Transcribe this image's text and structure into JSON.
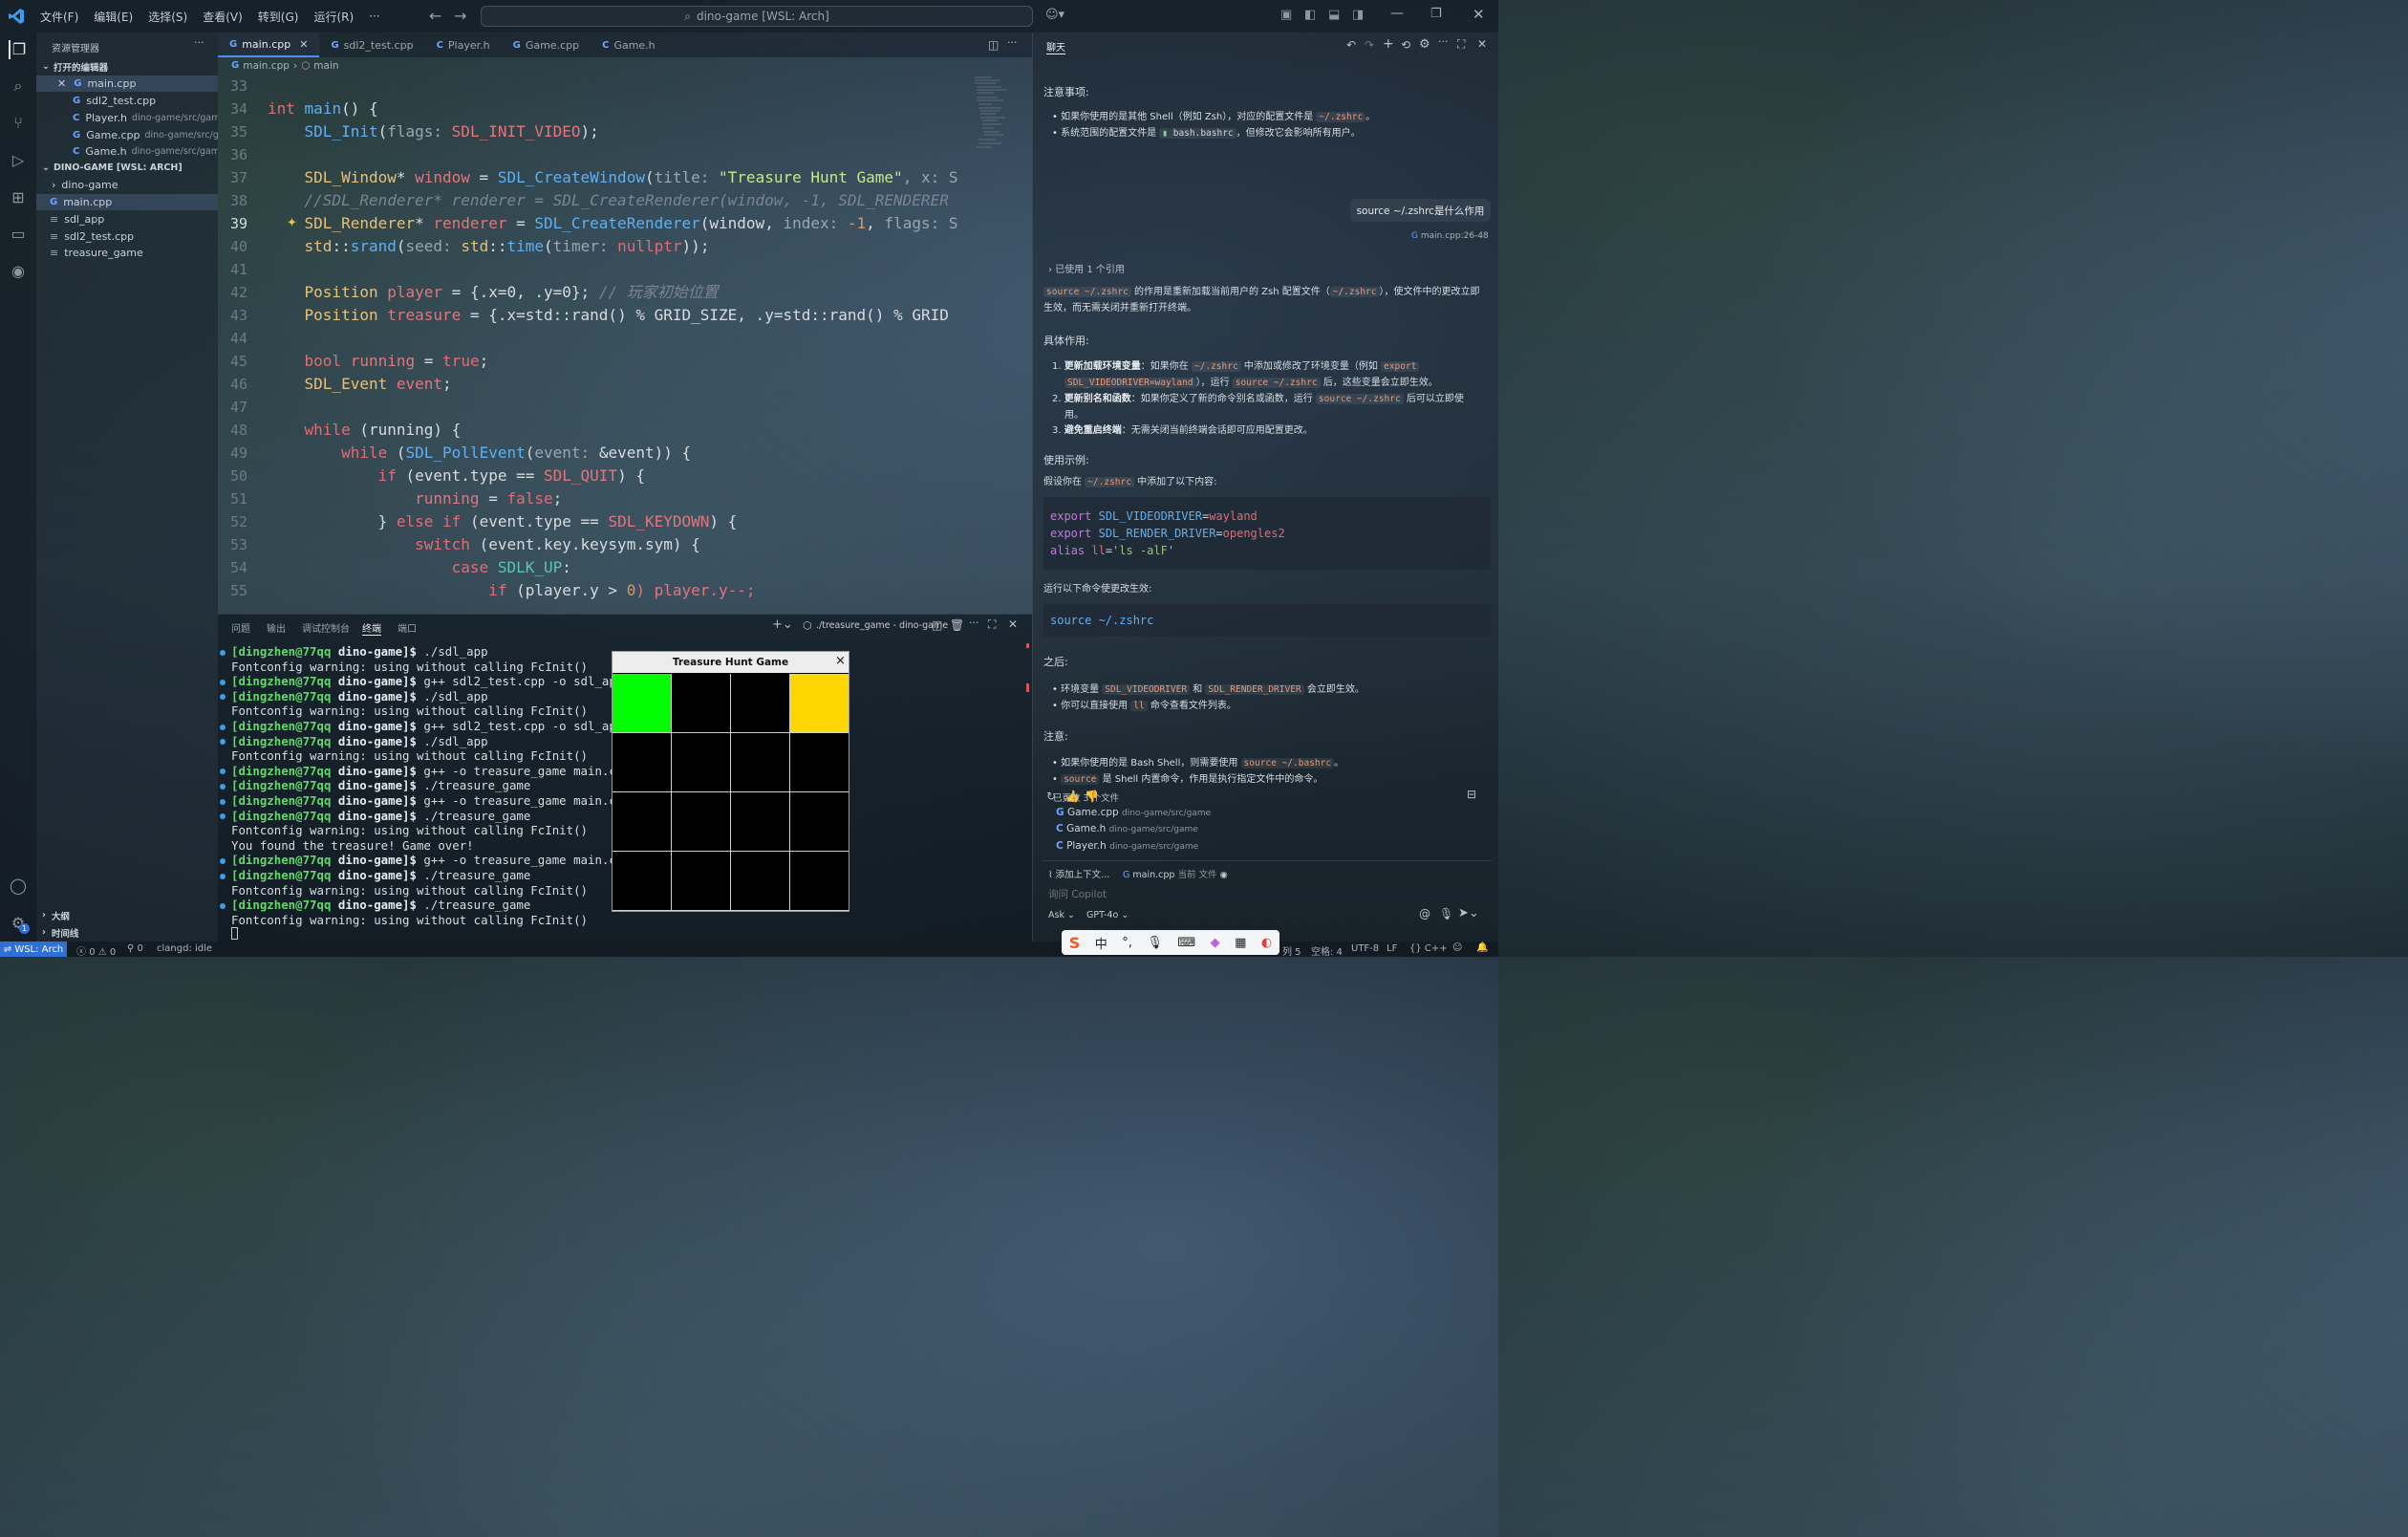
{
  "titlebar": {
    "menus": [
      "文件(F)",
      "编辑(E)",
      "选择(S)",
      "查看(V)",
      "转到(G)",
      "运行(R)",
      "···"
    ],
    "search_text": "dino-game [WSL: Arch]"
  },
  "explorer": {
    "title": "资源管理器",
    "open_editors_label": "打开的编辑器",
    "open_editors": [
      {
        "name": "main.cpp",
        "desc": ""
      },
      {
        "name": "sdl2_test.cpp",
        "desc": ""
      },
      {
        "name": "Player.h",
        "desc": "dino-game/src/game"
      },
      {
        "name": "Game.cpp",
        "desc": "dino-game/src/ga..."
      },
      {
        "name": "Game.h",
        "desc": "dino-game/src/game"
      }
    ],
    "workspace_label": "DINO-GAME [WSL: ARCH]",
    "files": [
      "dino-game",
      "main.cpp",
      "sdl_app",
      "sdl2_test.cpp",
      "treasure_game"
    ],
    "outline_label": "大纲",
    "timeline_label": "时间线"
  },
  "editor": {
    "tabs": [
      "main.cpp",
      "sdl2_test.cpp",
      "Player.h",
      "Game.cpp",
      "Game.h"
    ],
    "breadcrumb": {
      "file": "main.cpp",
      "symbol": "main"
    },
    "line_numbers": [
      "33",
      "34",
      "35",
      "36",
      "37",
      "38",
      "39",
      "40",
      "41",
      "42",
      "43",
      "44",
      "45",
      "46",
      "47",
      "48",
      "49",
      "50",
      "51",
      "52",
      "53",
      "54",
      "55"
    ],
    "current_line": "39",
    "code": {
      "l34": {
        "kw": "int",
        "fn": "main",
        "rest": "() {"
      },
      "l35": {
        "fn": "SDL_Init",
        "hint": "flags:",
        "arg": "SDL_INIT_VIDEO",
        "end": ");"
      },
      "l37": {
        "ty": "SDL_Window",
        "var": "window",
        "fn": "SDL_CreateWindow",
        "hint": "title:",
        "str": "\"Treasure Hunt Game\"",
        "tail": ", x: S"
      },
      "l38": {
        "text": "//SDL_Renderer* renderer = SDL_CreateRenderer(window, -1, SDL_RENDERER"
      },
      "l39": {
        "ty": "SDL_Renderer",
        "var": "renderer",
        "fn": "SDL_CreateRenderer",
        "arg1": "window",
        "hint2": "index:",
        "num": "-1",
        "hint3": "flags:",
        "tail": "S"
      },
      "l40": {
        "ns": "std",
        "fn": "srand",
        "hint": "seed:",
        "ns2": "std",
        "fn2": "time",
        "hint2": "timer:",
        "kw": "nullptr",
        "end": "));"
      },
      "l42": {
        "ty": "Position",
        "var": "player",
        "init": "{.x=0, .y=0};",
        "cm": "// 玩家初始位置"
      },
      "l43": {
        "ty": "Position",
        "var": "treasure",
        "init": "{.x=std::rand() % GRID_SIZE, .y=std::rand() % GRID"
      },
      "l45": {
        "kw": "bool",
        "var": "running",
        "val": "true",
        "end": ";"
      },
      "l46": {
        "ty": "SDL_Event",
        "var": "event",
        "end": ";"
      },
      "l48": {
        "kw": "while",
        "rest": "(running) {"
      },
      "l49": {
        "kw": "while",
        "fn": "SDL_PollEvent",
        "hint": "event:",
        "rest": "&event)) {"
      },
      "l50": {
        "kw": "if",
        "rest": "(event.type == ",
        "c": "SDL_QUIT",
        "end": ") {"
      },
      "l51": {
        "var": "running",
        "eq": " = ",
        "val": "false",
        "end": ";"
      },
      "l52": {
        "pre": "} ",
        "kw": "else if",
        "rest": "(event.type == ",
        "c": "SDL_KEYDOWN",
        "end": ") {"
      },
      "l53": {
        "kw": "switch",
        "rest": "(event.key.keysym.sym) {"
      },
      "l54": {
        "kw": "case",
        "c": "SDLK_UP",
        "end": ":"
      },
      "l55": {
        "kw": "if",
        "rest": "(player.y > ",
        "num": "0",
        "rest2": ") player.y--;"
      }
    }
  },
  "panel": {
    "tabs": [
      "问题",
      "输出",
      "调试控制台",
      "终端",
      "端口"
    ],
    "active_tab": "终端",
    "terminal_name": "./treasure_game - dino-game",
    "terminal_lines": [
      {
        "prompt": "[dingzhen@77qq",
        "dir": "dino-game]$",
        "cmd": " ./sdl_app",
        "dot": true
      },
      {
        "text": "Fontconfig warning: using without calling FcInit()"
      },
      {
        "prompt": "[dingzhen@77qq",
        "dir": "dino-game]$",
        "cmd": " g++ sdl2_test.cpp -o sdl_app `s",
        "dot": true
      },
      {
        "prompt": "[dingzhen@77qq",
        "dir": "dino-game]$",
        "cmd": " ./sdl_app",
        "dot": true
      },
      {
        "text": "Fontconfig warning: using without calling FcInit()"
      },
      {
        "prompt": "[dingzhen@77qq",
        "dir": "dino-game]$",
        "cmd": " g++ sdl2_test.cpp -o sdl_app `s",
        "dot": true
      },
      {
        "prompt": "[dingzhen@77qq",
        "dir": "dino-game]$",
        "cmd": " ./sdl_app",
        "dot": true
      },
      {
        "text": "Fontconfig warning: using without calling FcInit()"
      },
      {
        "prompt": "[dingzhen@77qq",
        "dir": "dino-game]$",
        "cmd": " g++ -o treasure_game main.cpp -",
        "dot": true
      },
      {
        "prompt": "[dingzhen@77qq",
        "dir": "dino-game]$",
        "cmd": " ./treasure_game",
        "dot": true
      },
      {
        "prompt": "[dingzhen@77qq",
        "dir": "dino-game]$",
        "cmd": " g++ -o treasure_game main.cpp -",
        "dot": true
      },
      {
        "prompt": "[dingzhen@77qq",
        "dir": "dino-game]$",
        "cmd": " ./treasure_game",
        "dot": true
      },
      {
        "text": "Fontconfig warning: using without calling FcInit()"
      },
      {
        "text": "You found the treasure! Game over!"
      },
      {
        "prompt": "[dingzhen@77qq",
        "dir": "dino-game]$",
        "cmd": " g++ -o treasure_game main.cpp -",
        "dot": true
      },
      {
        "prompt": "[dingzhen@77qq",
        "dir": "dino-game]$",
        "cmd": " ./treasure_game",
        "dot": true
      },
      {
        "text": "Fontconfig warning: using without calling FcInit()"
      },
      {
        "prompt": "[dingzhen@77qq",
        "dir": "dino-game]$",
        "cmd": " ./treasure_game",
        "dot": true
      },
      {
        "text": "Fontconfig warning: using without calling FcInit()"
      }
    ]
  },
  "game_window": {
    "title": "Treasure Hunt Game",
    "close_glyph": "×",
    "player_color": "#00ff00",
    "treasure_color": "#ffd700"
  },
  "chat": {
    "title": "聊天",
    "notes_heading": "注意事项:",
    "notes": [
      {
        "a": "如果你使用的是其他 Shell（例如 Zsh），对应的配置文件是 ",
        "code": "~/.zshrc",
        "b": "。"
      },
      {
        "a": "系统范围的配置文件是 ",
        "file": "bash.bashrc",
        "b": "，但修改它会影响所有用户。"
      }
    ],
    "user_question": "source ~/.zshrc是什么作用",
    "user_ref": "main.cpp:26-48",
    "refs_label": "已使用 1 个引用",
    "answer_intro": {
      "code1": "source ~/.zshrc",
      "a": " 的作用是重新加载当前用户的 Zsh 配置文件（",
      "code2": "~/.zshrc",
      "b": "），使文件中的更改立即",
      "line2": "生效，而无需关闭并重新打开终端。"
    },
    "specific_heading": "具体作用:",
    "specific": [
      {
        "bold": "更新加载环境变量",
        "a": "：如果你在 ",
        "c1": "~/.zshrc",
        "b": " 中添加或修改了环境变量（例如 ",
        "c2": "export",
        "c3": "SDL_VIDEODRIVER=wayland",
        "c": "），运行 ",
        "c4": "source ~/.zshrc",
        "d": " 后，这些变量会立即生效。"
      },
      {
        "bold": "更新别名和函数",
        "a": "：如果你定义了新的命令别名或函数，运行 ",
        "c1": "source ~/.zshrc",
        "b": " 后可以立即使",
        "line2": "用。"
      },
      {
        "bold": "避免重启终端",
        "a": "：无需关闭当前终端会话即可应用配置更改。"
      }
    ],
    "example_heading": "使用示例:",
    "example_intro": {
      "a": "假设你在 ",
      "code": "~/.zshrc",
      "b": " 中添加了以下内容:"
    },
    "example_code": [
      {
        "kw": "export",
        "var": "SDL_VIDEODRIVER",
        "val": "wayland"
      },
      {
        "kw": "export",
        "var": "SDL_RENDER_DRIVER",
        "val": "opengles2"
      },
      {
        "kw": "alias",
        "var": "ll",
        "str": "'ls -alF'"
      }
    ],
    "run_text": "运行以下命令使更改生效:",
    "run_code": "source ~/.zshrc",
    "after_heading": "之后:",
    "after": [
      {
        "a": "环境变量 ",
        "c1": "SDL_VIDEODRIVER",
        "b": " 和 ",
        "c2": "SDL_RENDER_DRIVER",
        "c": " 会立即生效。"
      },
      {
        "a": "你可以直接使用 ",
        "c1": "ll",
        "b": " 命令查看文件列表。"
      }
    ],
    "note_heading": "注意:",
    "note_items": [
      {
        "a": "如果你使用的是 Bash Shell，则需要使用 ",
        "c1": "source ~/.bashrc",
        "b": "。"
      },
      {
        "a": "",
        "c1": "source",
        "b": " 是 Shell 内置命令，作用是执行指定文件中的命令。"
      }
    ],
    "changed_label": "已更改 3 个文件",
    "changed_files": [
      {
        "name": "Game.cpp",
        "path": "dino-game/src/game"
      },
      {
        "name": "Game.h",
        "path": "dino-game/src/game"
      },
      {
        "name": "Player.h",
        "path": "dino-game/src/game"
      }
    ],
    "add_context": "添加上下文...",
    "current_file": "main.cpp",
    "current_file_label": "当前 文件",
    "input_placeholder": "询问 Copilot",
    "mode": "Ask",
    "model": "GPT-4o"
  },
  "statusbar": {
    "remote": "WSL: Arch",
    "errors": "0",
    "warnings": "0",
    "ports": "0",
    "clangd": "clangd: idle",
    "col": "列 5",
    "spaces": "空格: 4",
    "encoding": "UTF-8",
    "eol": "LF",
    "lang": "C++",
    "notify_count": "1"
  },
  "ime": {
    "cn": "中"
  },
  "icons": [
    "vscode-logo-icon",
    "files-icon",
    "search-icon",
    "source-control-icon",
    "run-debug-icon",
    "extensions-icon",
    "remote-explorer-icon",
    "account-icon",
    "settings-gear-icon"
  ]
}
